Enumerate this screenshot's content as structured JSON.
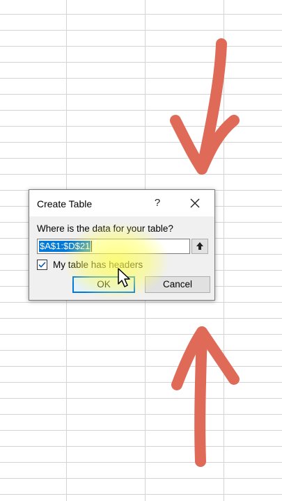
{
  "dialog": {
    "title": "Create Table",
    "help_glyph": "?",
    "prompt": "Where is the data for your table?",
    "range_value": "$A$1:$D$21",
    "headers_checkbox": {
      "label": "My table has headers",
      "checked": true
    },
    "ok_label": "OK",
    "cancel_label": "Cancel"
  },
  "icons": {
    "close": "close-icon",
    "collapse": "collapse-dialog-icon",
    "cursor": "mouse-pointer-icon",
    "arrows": "hand-drawn-arrow-icon"
  },
  "colors": {
    "arrow": "#e06a58",
    "selection": "#0078d7",
    "highlight": "#ffff55"
  }
}
